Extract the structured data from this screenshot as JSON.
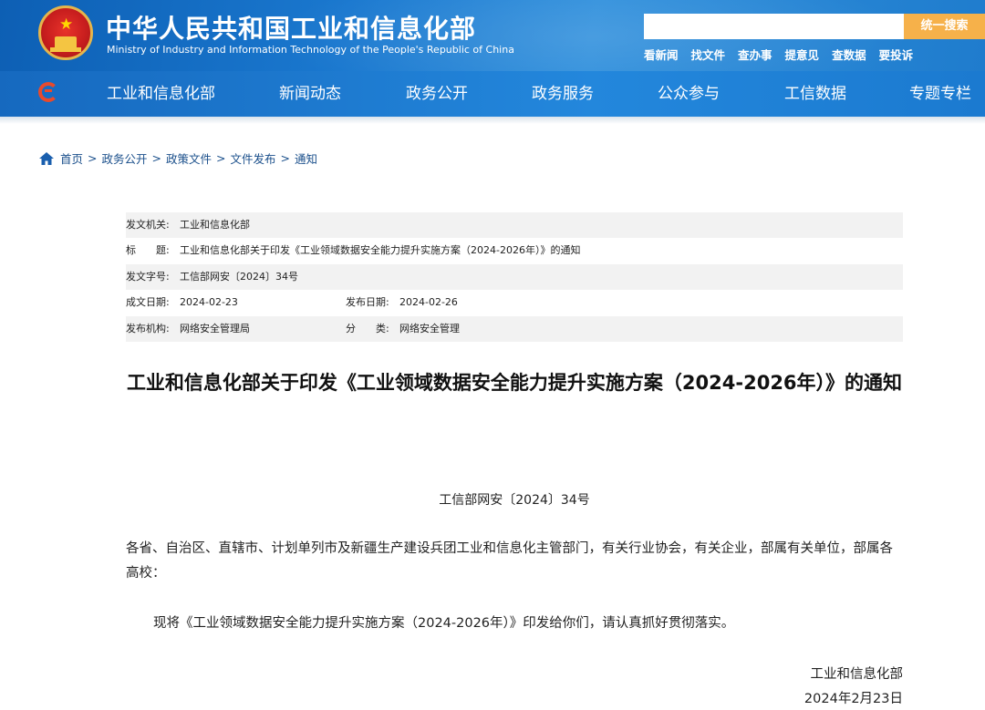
{
  "header": {
    "title_cn": "中华人民共和国工业和信息化部",
    "title_en": "Ministry of Industry and Information Technology of the People's Republic of China",
    "search_placeholder": "",
    "search_button": "统一搜索",
    "quick_links": [
      "看新闻",
      "找文件",
      "查办事",
      "提意见",
      "查数据",
      "要投诉"
    ]
  },
  "nav": {
    "items": [
      "工业和信息化部",
      "新闻动态",
      "政务公开",
      "政务服务",
      "公众参与",
      "工信数据",
      "专题专栏"
    ]
  },
  "breadcrumb": [
    "首页",
    "政务公开",
    "政策文件",
    "文件发布",
    "通知"
  ],
  "meta": {
    "issuer_label": "发文机关:",
    "issuer": "工业和信息化部",
    "title_label": "标　　题:",
    "title": "工业和信息化部关于印发《工业领域数据安全能力提升实施方案（2024-2026年）》的通知",
    "docno_label": "发文字号:",
    "docno": "工信部网安〔2024〕34号",
    "created_label": "成文日期:",
    "created": "2024-02-23",
    "published_label": "发布日期:",
    "published": "2024-02-26",
    "org_label": "发布机构:",
    "org": "网络安全管理局",
    "category_label": "分　　类:",
    "category": "网络安全管理"
  },
  "document": {
    "title": "工业和信息化部关于印发《工业领域数据安全能力提升实施方案（2024-2026年）》的通知",
    "number": "工信部网安〔2024〕34号",
    "recipients": "各省、自治区、直辖市、计划单列市及新疆生产建设兵团工业和信息化主管部门，有关行业协会，有关企业，部属有关单位，部属各高校：",
    "body": "现将《工业领域数据安全能力提升实施方案（2024-2026年）》印发给你们，请认真抓好贯彻落实。",
    "signature": "工业和信息化部",
    "date": "2024年2月23日"
  },
  "colors": {
    "header_blue": "#1a78cf",
    "search_button": "#f6b14a",
    "breadcrumb": "#1a4f8b",
    "meta_shade": "#f2f2f2"
  }
}
